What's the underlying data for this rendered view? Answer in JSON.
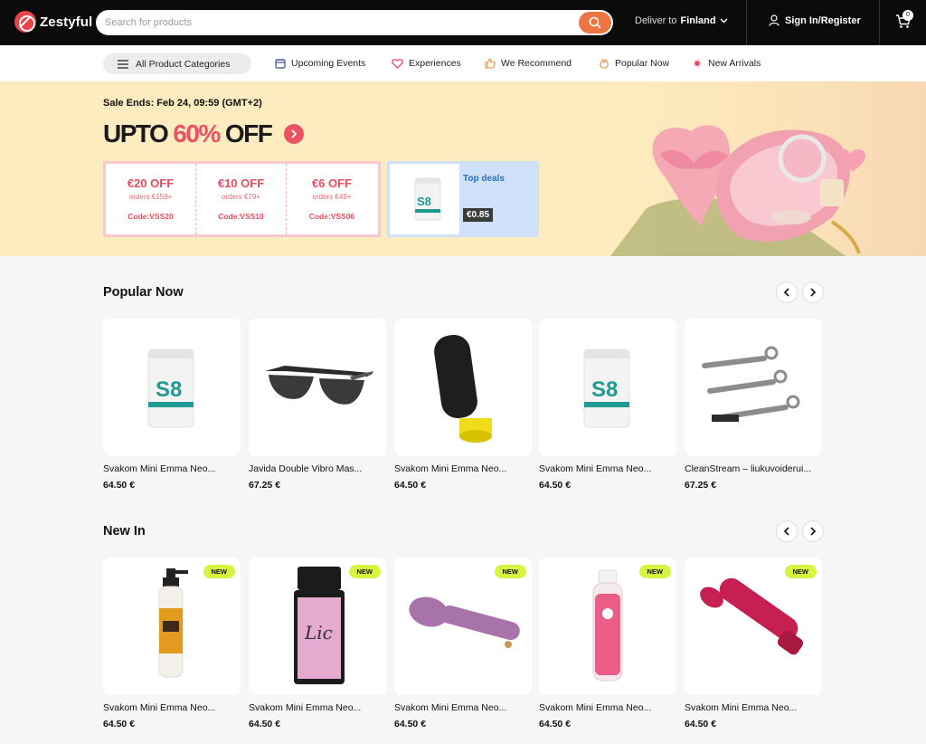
{
  "header": {
    "brand": "Zestyful",
    "search_placeholder": "Search for products",
    "deliver_label": "Deliver to",
    "deliver_country": "Finland",
    "signin_label": "Sign In/Register",
    "cart_count": "0"
  },
  "catnav": {
    "all_categories": "All Product Categories",
    "items": [
      "Upcoming Events",
      "Experiences",
      "We Recommend",
      "Popular Now",
      "New Arrivals"
    ]
  },
  "banner": {
    "sale_ends": "Sale Ends: Feb 24, 09:59 (GMT+2)",
    "upto_prefix": "UPTO",
    "upto_pct": "60%",
    "upto_suffix": "OFF",
    "coupons": [
      {
        "amount": "€20 OFF",
        "min": "orders €159+",
        "code": "Code:VSS20"
      },
      {
        "amount": "€10 OFF",
        "min": "orders €79+",
        "code": "Code:VSS10"
      },
      {
        "amount": "€6 OFF",
        "min": "orders €49+",
        "code": "Code:VSS06"
      }
    ],
    "top_deals_label": "Top deals",
    "top_deals_price": "€0.85"
  },
  "popular": {
    "title": "Popular Now",
    "products": [
      {
        "name": "Svakom Mini Emma Neo...",
        "price": "64.50 €",
        "icon": "supplement-jar"
      },
      {
        "name": "Javida Double Vibro Mas...",
        "price": "67.25 €",
        "icon": "sunglasses"
      },
      {
        "name": "Svakom Mini Emma Neo...",
        "price": "64.50 €",
        "icon": "black-canister"
      },
      {
        "name": "Svakom Mini Emma Neo...",
        "price": "64.50 €",
        "icon": "supplement-jar"
      },
      {
        "name": "CleanStream – liukuvoideruі...",
        "price": "67.25 €",
        "icon": "applicator-syringes"
      }
    ]
  },
  "newin": {
    "title": "New In",
    "badge": "NEW",
    "products": [
      {
        "name": "Svakom Mini Emma Neo...",
        "price": "64.50 €",
        "icon": "pump-bottle"
      },
      {
        "name": "Svakom Mini Emma Neo...",
        "price": "64.50 €",
        "icon": "pink-canister"
      },
      {
        "name": "Svakom Mini Emma Neo...",
        "price": "64.50 €",
        "icon": "wand-massager"
      },
      {
        "name": "Svakom Mini Emma Neo...",
        "price": "64.50 €",
        "icon": "lube-bottle"
      },
      {
        "name": "Svakom Mini Emma Neo...",
        "price": "64.50 €",
        "icon": "red-vibrator"
      }
    ]
  },
  "colors": {
    "accent": "#ee7442",
    "sale_pink": "#ec5263",
    "banner_bg": "#fdecbf",
    "new_badge": "#d8f43e"
  }
}
